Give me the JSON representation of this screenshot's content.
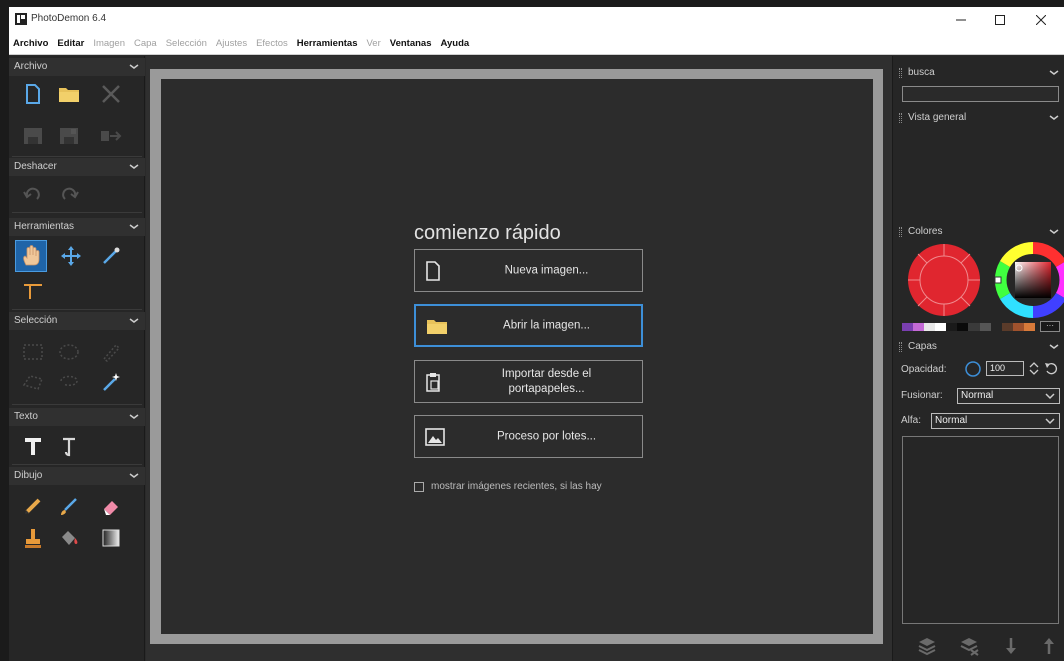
{
  "window": {
    "title": "PhotoDemon 6.4"
  },
  "menu": [
    {
      "label": "Archivo",
      "enabled": true
    },
    {
      "label": "Editar",
      "enabled": true
    },
    {
      "label": "Imagen",
      "enabled": false
    },
    {
      "label": "Capa",
      "enabled": false
    },
    {
      "label": "Selección",
      "enabled": false
    },
    {
      "label": "Ajustes",
      "enabled": false
    },
    {
      "label": "Efectos",
      "enabled": false
    },
    {
      "label": "Herramientas",
      "enabled": true
    },
    {
      "label": "Ver",
      "enabled": false
    },
    {
      "label": "Ventanas",
      "enabled": true
    },
    {
      "label": "Ayuda",
      "enabled": true
    }
  ],
  "toolbox": {
    "archivo": "Archivo",
    "deshacer": "Deshacer",
    "herramientas": "Herramientas",
    "seleccion": "Selección",
    "texto": "Texto",
    "dibujo": "Dibujo"
  },
  "quickstart": {
    "title": "comienzo rápido",
    "new_image": "Nueva imagen...",
    "open_image": "Abrir la imagen...",
    "import_clipboard_line1": "Importar desde el",
    "import_clipboard_line2": "portapapeles...",
    "batch": "Proceso por lotes...",
    "show_recent": "mostrar imágenes recientes, si las hay"
  },
  "right_panel": {
    "search_head": "busca",
    "overview_head": "Vista general",
    "colors_head": "Colores",
    "layers_head": "Capas",
    "opacity_label": "Opacidad:",
    "opacity_value": "100",
    "blend_label": "Fusionar:",
    "blend_value": "Normal",
    "alpha_label": "Alfa:",
    "alpha_value": "Normal",
    "more_colors": "···",
    "primary_color": "#e0262f",
    "palette_colors": [
      "#7a3fb0",
      "#c46ad6",
      "#e8e8e8",
      "#ffffff",
      "#1a1a1a",
      "#0a0a0a",
      "#3a3a3a",
      "#555555",
      "#262626",
      "#5a3b2a",
      "#a0522d",
      "#d87a3a"
    ]
  }
}
